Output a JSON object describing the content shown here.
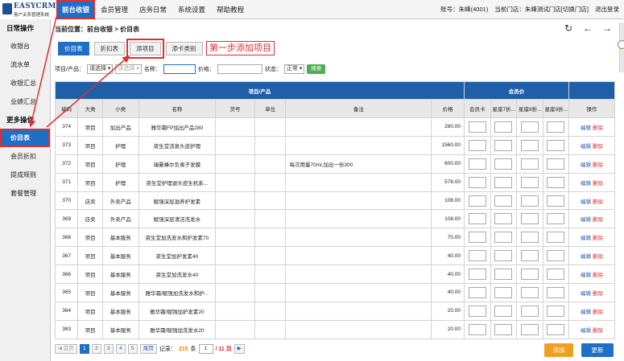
{
  "logo": {
    "title": "EASYCRM",
    "subtitle": "客户关系管理系统"
  },
  "nav": [
    "前台收银",
    "会员管理",
    "店务日常",
    "系统设置",
    "帮助教程"
  ],
  "user": {
    "account": "账号：朱峰(4001)",
    "store": "当前门店：朱峰测试门店",
    "switch": "[切换门店]",
    "logout": "退出登录"
  },
  "sidebar": {
    "section1": "日常操作",
    "items1": [
      "收银台",
      "流水单",
      "收银汇总",
      "业绩汇总"
    ],
    "section2": "更多操作",
    "items2": [
      "价目表",
      "会员折扣",
      "提成规则",
      "套餐管理"
    ]
  },
  "breadcrumb": "当前位置：前台收银 > 价目表",
  "tabs": [
    "价目表",
    "折扣表",
    "添项目",
    "添卡类别"
  ],
  "callout": "第一步添加项目",
  "filters": {
    "cat_label": "项目/产品：",
    "cat_value": "请选择",
    "sub_value": "请选择",
    "name_label": "名称：",
    "price_label": "价格：",
    "status_label": "状态：",
    "status_value": "正常",
    "search": "搜索"
  },
  "table": {
    "group1": "项目/产品",
    "group2": "会员价",
    "columns": [
      "编码",
      "大类",
      "小类",
      "名称",
      "货号",
      "单位",
      "备注",
      "价格",
      "会员卡",
      "星座7折...",
      "星座8折...",
      "星座9折...",
      "操作"
    ],
    "edit": "编辑",
    "delete": "删除",
    "rows": [
      [
        "374",
        "项目",
        "加出产品",
        "雅华霜FP加出产品280",
        "",
        "",
        "",
        "280.00"
      ],
      [
        "373",
        "项目",
        "护理",
        "资生堂活泉头皮护理",
        "",
        "",
        "",
        "1560.00"
      ],
      [
        "372",
        "项目",
        "护理",
        "瑞曼蜂尔负离子发膜",
        "",
        "",
        "每次用量70ml,加出一份300",
        "600.00"
      ],
      [
        "371",
        "项目",
        "护理",
        "资生堂护理退头皮生机系...",
        "",
        "",
        "",
        "576.00"
      ],
      [
        "370",
        "店卖",
        "外卖产品",
        "赋强深层滋养护发素",
        "",
        "",
        "",
        "108.00"
      ],
      [
        "369",
        "店卖",
        "外卖产品",
        "赋强深层清洁洗发水",
        "",
        "",
        "",
        "108.00"
      ],
      [
        "368",
        "项目",
        "基本服务",
        "资生堂加洗发水和护发素70",
        "",
        "",
        "",
        "70.00"
      ],
      [
        "367",
        "项目",
        "基本服务",
        "资生堂加护发素40",
        "",
        "",
        "",
        "40.00"
      ],
      [
        "366",
        "项目",
        "基本服务",
        "资生堂加洗发水40",
        "",
        "",
        "",
        "40.00"
      ],
      [
        "365",
        "项目",
        "基本服务",
        "雅华霜/赋强加洗发水和护...",
        "",
        "",
        "",
        "40.00"
      ],
      [
        "364",
        "项目",
        "基本服务",
        "雅华霜/赋强加护发素20",
        "",
        "",
        "",
        "20.00"
      ],
      [
        "363",
        "项目",
        "基本服务",
        "雅华霜/赋强加洗发水20",
        "",
        "",
        "",
        "20.00"
      ]
    ]
  },
  "pager": {
    "first": "◀ 首页",
    "pages": [
      "1",
      "2",
      "3",
      "4",
      "5"
    ],
    "last": "尾页",
    "records_label": "记录：",
    "records": "215",
    "records_unit": "条",
    "current": "1",
    "total": "/ 11 页",
    "go": "▶"
  },
  "buttons": {
    "add": "添加",
    "refresh": "更新"
  },
  "icons": {
    "refresh": "refresh-icon",
    "back": "back-arrow-icon",
    "forward": "forward-arrow-icon"
  },
  "colors": {
    "primary": "#1f6fc6",
    "header": "#1f5fa8",
    "annotation": "#e02d2d",
    "add": "#f0a020",
    "search": "#4caf50"
  }
}
